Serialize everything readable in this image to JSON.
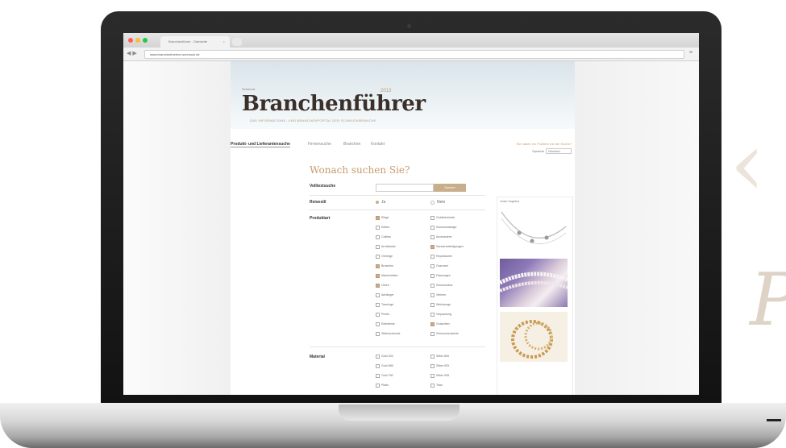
{
  "browser": {
    "tab_title": "Branchenführer - Startseite",
    "url": "www.branchenfuehrer-schmuck.de",
    "traffic_colors": [
      "#ff5f57",
      "#febc2e",
      "#28c840"
    ]
  },
  "site": {
    "logo_small": "Schmuck",
    "logo": "Branchenführer",
    "logo_sup": "2013",
    "tagline": "DAS INFORMATIONS- UND BRANCHENPORTAL DER SCHMUCKBRANCHE",
    "accent": "#c79b6e"
  },
  "nav": {
    "items": [
      "Produkt- und Lieferantensuche",
      "Firmensuche",
      "Branchen",
      "Kontakt"
    ],
    "search_link": "Sie haben ein Problem mit der Suche?",
    "lang_label": "Sprache",
    "lang_value": "Deutsch"
  },
  "form": {
    "title": "Wonach suchen Sie?",
    "fulltext_label": "Volltextsuche",
    "search_button": "Suchen",
    "domestic_label": "Reisestil",
    "radio_yes": "Ja",
    "radio_no": "Nein",
    "product_label": "Produktart",
    "material_label": "Material",
    "products_col1": [
      "Ringe",
      "Ketten",
      "Colliers",
      "Armbänder",
      "Ohrringe",
      "Broschen",
      "Manschetten",
      "Uhren",
      "Anhänger",
      "Trauringe",
      "Perlen",
      "Edelsteine",
      "Silberschmuck"
    ],
    "products_col2": [
      "Goldschmiede",
      "Schmuckdesign",
      "Accessoires",
      "Sonderanfertigungen",
      "Reparaturen",
      "Gravuren",
      "Fassungen",
      "Schmuckbox",
      "Vitrinen",
      "Werkzeuge",
      "Verpackung",
      "Gutachten",
      "Schmuckzubehör"
    ],
    "products_col1_checked": [
      true,
      false,
      false,
      false,
      false,
      true,
      true,
      true,
      false,
      false,
      false,
      false,
      false
    ],
    "products_col2_checked": [
      false,
      false,
      false,
      true,
      false,
      false,
      false,
      false,
      false,
      false,
      false,
      true,
      false
    ],
    "material_col1": [
      "Gold 333",
      "Gold 585",
      "Gold 750",
      "Platin"
    ],
    "material_col2": [
      "Silber 800",
      "Silber 925",
      "Silber 935",
      "Titan"
    ]
  },
  "sidebar": {
    "caption": "Unser Angebot"
  }
}
